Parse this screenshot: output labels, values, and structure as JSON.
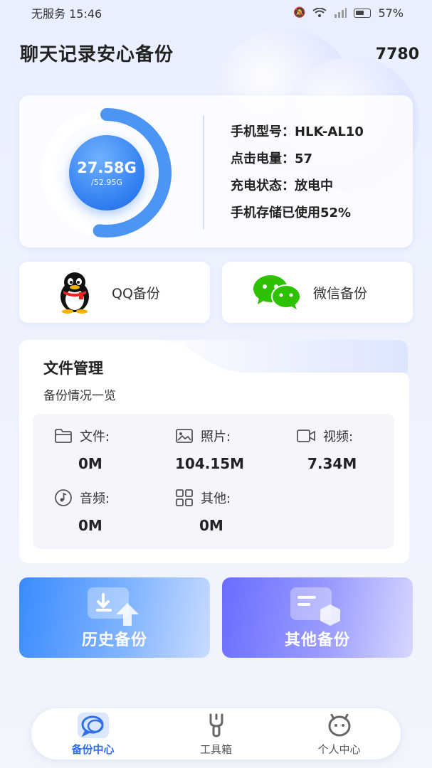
{
  "status_bar": {
    "carrier": "无服务",
    "time": "15:46",
    "battery": "57%"
  },
  "header": {
    "title": "聊天记录安心备份",
    "count": "7780"
  },
  "storage": {
    "used": "27.58G",
    "total": "/52.95G",
    "used_fraction": 0.52,
    "accent_color": "#2f7df0"
  },
  "device_info": [
    {
      "text": "手机型号：HLK-AL10"
    },
    {
      "text": "点击电量：57"
    },
    {
      "text": "充电状态：放电中"
    },
    {
      "text": "手机存储已使用52%"
    }
  ],
  "backup_buttons": {
    "qq": "QQ备份",
    "wechat": "微信备份"
  },
  "file_management": {
    "title": "文件管理",
    "subtitle": "备份情况一览",
    "items": [
      {
        "icon": "folder-icon",
        "label": "文件:",
        "value": "0M"
      },
      {
        "icon": "image-icon",
        "label": "照片:",
        "value": "104.15M"
      },
      {
        "icon": "video-icon",
        "label": "视频:",
        "value": "7.34M"
      },
      {
        "icon": "music-icon",
        "label": "音频:",
        "value": "0M"
      },
      {
        "icon": "grid-icon",
        "label": "其他:",
        "value": "0M"
      }
    ]
  },
  "big_cards": {
    "history": "历史备份",
    "other": "其他备份"
  },
  "tabs": [
    {
      "label": "备份中心",
      "icon": "chat-bubble-icon",
      "active": true
    },
    {
      "label": "工具箱",
      "icon": "wrench-icon",
      "active": false
    },
    {
      "label": "个人中心",
      "icon": "face-icon",
      "active": false
    }
  ]
}
